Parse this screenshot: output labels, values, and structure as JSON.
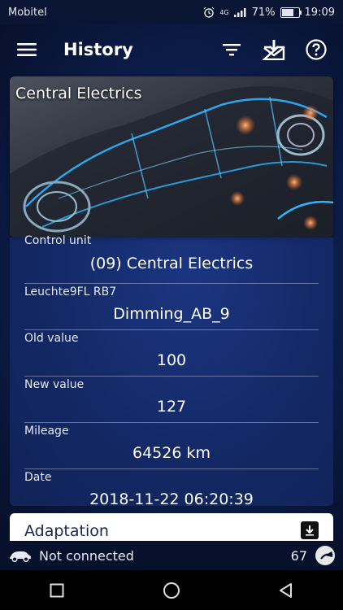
{
  "statusbar": {
    "carrier": "Mobitel",
    "network": "4G",
    "battery": "71%",
    "time": "19:09",
    "icons": [
      "alarm-icon",
      "signal-icon",
      "battery-icon"
    ]
  },
  "toolbar": {
    "title": "History",
    "icons": [
      "menu-icon",
      "filter-icon",
      "mail-download-icon",
      "help-icon"
    ]
  },
  "hero": {
    "title": "Central Electrics"
  },
  "details": {
    "rows": [
      {
        "label": "Control unit",
        "value": "(09) Central Electrics"
      },
      {
        "label": "Leuchte9FL RB7",
        "value": "Dimming_AB_9"
      },
      {
        "label": "Old value",
        "value": "100"
      },
      {
        "label": "New value",
        "value": "127"
      },
      {
        "label": "Mileage",
        "value": "64526 km"
      },
      {
        "label": "Date",
        "value": "2018-11-22 06:20:39"
      }
    ]
  },
  "adaptation": {
    "label": "Adaptation",
    "icon": "download-box-icon"
  },
  "connection": {
    "status": "Not connected",
    "count": "67",
    "icons": [
      "car-icon",
      "gauge-icon"
    ]
  },
  "navbar": {
    "icons": [
      "recents-square-icon",
      "home-circle-icon",
      "back-triangle-icon"
    ]
  },
  "colors": {
    "background": "#0c1d4a",
    "card": "#1e3a8a",
    "accent_glow": "#2fb4ff"
  }
}
